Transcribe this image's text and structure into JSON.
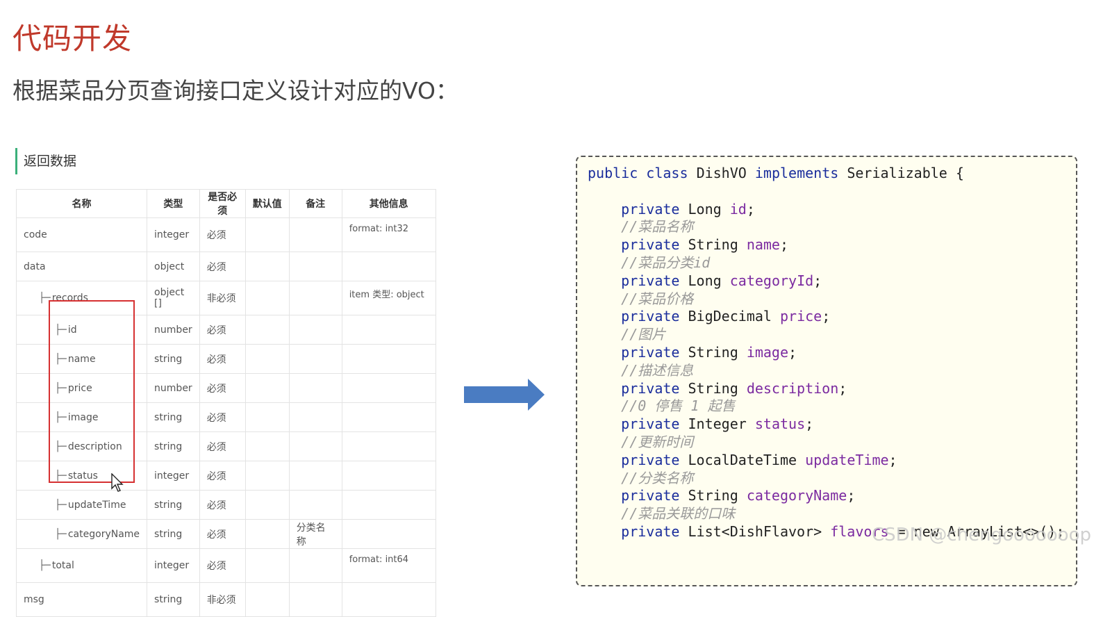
{
  "slide": {
    "title": "代码开发",
    "subtitle": "根据菜品分页查询接口定义设计对应的VO："
  },
  "section": {
    "label": "返回数据"
  },
  "table": {
    "headers": [
      "名称",
      "类型",
      "是否必须",
      "默认值",
      "备注",
      "其他信息"
    ],
    "rows": [
      {
        "name": "code",
        "type": "integer",
        "required": "必须",
        "default": "",
        "note": "",
        "info": "format: int32"
      },
      {
        "name": "data",
        "type": "object",
        "required": "必须",
        "default": "",
        "note": "",
        "info": ""
      },
      {
        "name": "records",
        "type": "object []",
        "required": "非必须",
        "default": "",
        "note": "",
        "info": "item 类型: object"
      },
      {
        "name": "id",
        "type": "number",
        "required": "必须",
        "default": "",
        "note": "",
        "info": ""
      },
      {
        "name": "name",
        "type": "string",
        "required": "必须",
        "default": "",
        "note": "",
        "info": ""
      },
      {
        "name": "price",
        "type": "number",
        "required": "必须",
        "default": "",
        "note": "",
        "info": ""
      },
      {
        "name": "image",
        "type": "string",
        "required": "必须",
        "default": "",
        "note": "",
        "info": ""
      },
      {
        "name": "description",
        "type": "string",
        "required": "必须",
        "default": "",
        "note": "",
        "info": ""
      },
      {
        "name": "status",
        "type": "integer",
        "required": "必须",
        "default": "",
        "note": "",
        "info": ""
      },
      {
        "name": "updateTime",
        "type": "string",
        "required": "必须",
        "default": "",
        "note": "",
        "info": ""
      },
      {
        "name": "categoryName",
        "type": "string",
        "required": "必须",
        "default": "",
        "note": "分类名称",
        "info": ""
      },
      {
        "name": "total",
        "type": "integer",
        "required": "必须",
        "default": "",
        "note": "",
        "info": "format: int64"
      },
      {
        "name": "msg",
        "type": "string",
        "required": "非必须",
        "default": "",
        "note": "",
        "info": ""
      }
    ]
  },
  "code": {
    "l0": [
      "public",
      "class",
      "DishVO",
      "implements",
      "Serializable {"
    ],
    "f1": [
      "private",
      "Long",
      "id"
    ],
    "c1": "//菜品名称",
    "f2": [
      "private",
      "String",
      "name"
    ],
    "c2": "//菜品分类id",
    "f3": [
      "private",
      "Long",
      "categoryId"
    ],
    "c3": "//菜品价格",
    "f4": [
      "private",
      "BigDecimal",
      "price"
    ],
    "c4": "//图片",
    "f5": [
      "private",
      "String",
      "image"
    ],
    "c5": "//描述信息",
    "f6": [
      "private",
      "String",
      "description"
    ],
    "c6": "//0 停售 1 起售",
    "f7": [
      "private",
      "Integer",
      "status"
    ],
    "c7": "//更新时间",
    "f8": [
      "private",
      "LocalDateTime",
      "updateTime"
    ],
    "c8": "//分类名称",
    "f9": [
      "private",
      "String",
      "categoryName"
    ],
    "c9": "//菜品关联的口味",
    "f10": [
      "private",
      "List<DishFlavor>",
      "flavors",
      "= new ArrayList<>();"
    ]
  },
  "watermark": "CSDN @chengooooooop",
  "colors": {
    "title": "#c0392b",
    "section_bar": "#3bb07a",
    "highlight_box": "#d63031",
    "arrow": "#4a7cc2",
    "code_bg": "#fffef0",
    "keyword": "#1a2d9c",
    "field": "#7b2aa0",
    "comment": "#999999"
  },
  "icons": {
    "arrow": "right-arrow-icon",
    "cursor": "mouse-pointer-icon",
    "tree": "tree-branch-icon"
  }
}
